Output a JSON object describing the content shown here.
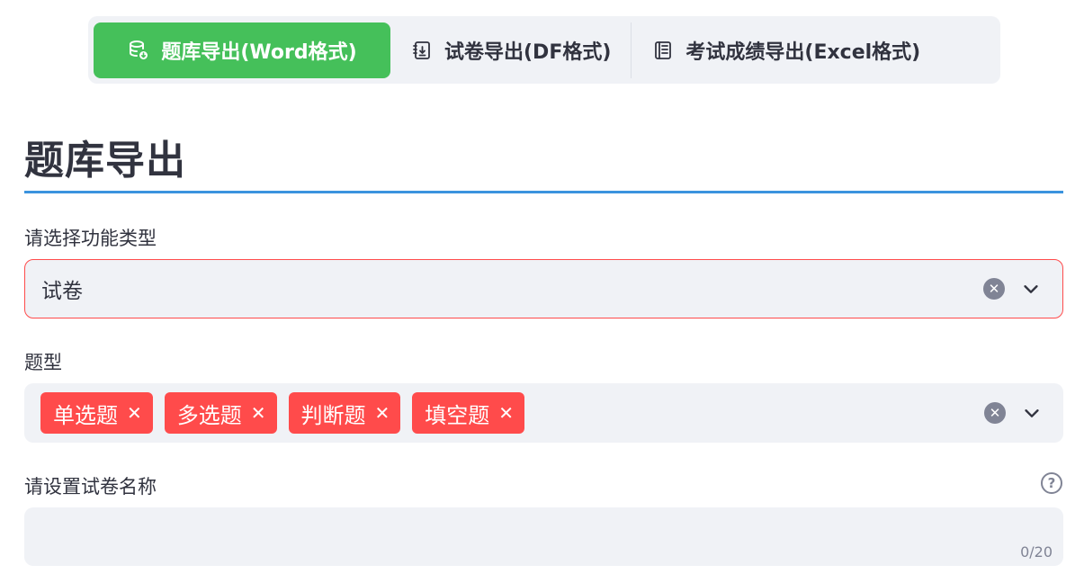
{
  "tabs": [
    {
      "label": "题库导出(Word格式)",
      "icon": "database-download-icon",
      "active": true
    },
    {
      "label": "试卷导出(DF格式)",
      "icon": "file-import-icon",
      "active": false
    },
    {
      "label": "考试成绩导出(Excel格式)",
      "icon": "journal-icon",
      "active": false
    }
  ],
  "page": {
    "title": "题库导出"
  },
  "function_select": {
    "label": "请选择功能类型",
    "value": "试卷"
  },
  "question_types": {
    "label": "题型",
    "tags": [
      "单选题",
      "多选题",
      "判断题",
      "填空题"
    ],
    "remove_glyph": "✕"
  },
  "paper_name": {
    "label": "请设置试卷名称",
    "value": "",
    "counter": "0/20",
    "help_glyph": "?"
  },
  "colors": {
    "accent_green": "#45c05a",
    "tag_red": "#ff4b4b",
    "rule_blue": "#3b93de",
    "field_bg": "#f0f2f6"
  }
}
